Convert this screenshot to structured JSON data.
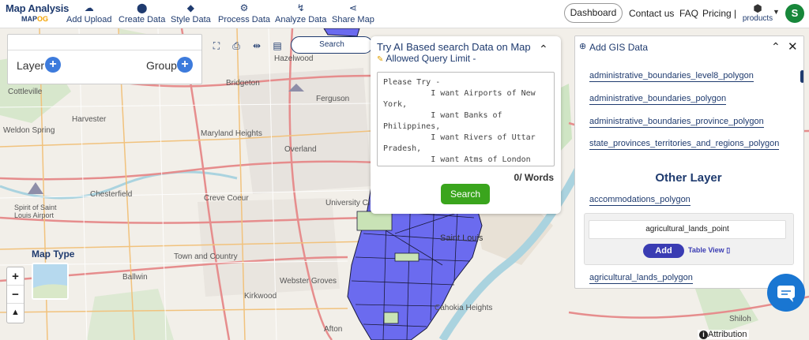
{
  "brand": {
    "title": "Map Analysis",
    "sub_prefix": "MAP",
    "sub_suffix": "OG"
  },
  "nav": [
    {
      "label": "Add Upload",
      "icon": "cloud-upload-icon",
      "glyph": "☁"
    },
    {
      "label": "Create Data",
      "icon": "map-pin-icon",
      "glyph": "⬤"
    },
    {
      "label": "Style Data",
      "icon": "paint-bucket-icon",
      "glyph": "◆"
    },
    {
      "label": "Process Data",
      "icon": "process-icon",
      "glyph": "⚙"
    },
    {
      "label": "Analyze Data",
      "icon": "analyze-icon",
      "glyph": "↯"
    },
    {
      "label": "Share Map",
      "icon": "share-icon",
      "glyph": "⋖"
    }
  ],
  "header_right": {
    "dashboard": "Dashboard",
    "contact": "Contact us",
    "faq": "FAQ",
    "pricing": "Pricing |",
    "products": "products",
    "avatar_initial": "S"
  },
  "layer_panel": {
    "layer_label": "Layer",
    "group_label": "Group"
  },
  "map_search": {
    "placeholder": "Search"
  },
  "ai_panel": {
    "title": "Try AI Based search Data on Map",
    "subtitle": "Allowed Query Limit -",
    "placeholder": "Please Try -\n          I want Airports of New York,\n          I want Banks of Philippines,\n          I want Rivers of Uttar Pradesh,\n          I want Atms of London",
    "words": "0/ Words",
    "search_label": "Search"
  },
  "gis_panel": {
    "title": "Add GIS Data",
    "links_top": [
      "administrative_boundaries_level8_polygon",
      "administrative_boundaries_polygon",
      "administrative_boundaries_province_polygon",
      "state_provinces_territories_and_regions_polygon"
    ],
    "other_layer_heading": "Other Layer",
    "other_links": [
      "accommodations_polygon"
    ],
    "selected_layer": "agricultural_lands_point",
    "add_label": "Add",
    "table_view_label": "Table View",
    "after_card_link": "agricultural_lands_polygon"
  },
  "map_labels": [
    "Hazelwood",
    "Cottleville",
    "Bridgeton",
    "Ferguson",
    "Harvester",
    "Weldon Spring",
    "Maryland Heights",
    "Overland",
    "Chesterfield",
    "Creve Coeur",
    "University City",
    "Saint Louis",
    "Spirit of Saint Louis Airport",
    "Town and Country",
    "Ballwin",
    "Webster Groves",
    "Kirkwood",
    "Afton",
    "Cahokia Heights",
    "Shiloh"
  ],
  "map_type_label": "Map Type",
  "zoom": {
    "in": "+",
    "out": "−",
    "reset": "▲"
  },
  "attribution": "Attribution",
  "colors": {
    "navy": "#1f3b6f",
    "green": "#3aa51d",
    "polygon_fill": "#6b6bef",
    "add_button": "#3a3cb3",
    "chat": "#1976d2"
  }
}
